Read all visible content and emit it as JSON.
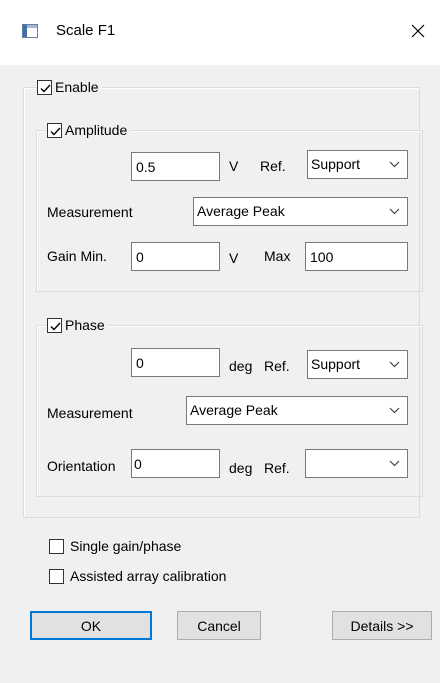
{
  "window": {
    "title": "Scale F1",
    "app_icon": "window-icon",
    "close_icon": "close-icon"
  },
  "enable": {
    "label": "Enable",
    "checked": true
  },
  "amplitude": {
    "label": "Amplitude",
    "checked": true,
    "value": "0.5",
    "unit": "V",
    "ref_label": "Ref.",
    "ref_value": "Support",
    "measurement_label": "Measurement",
    "measurement_value": "Average Peak",
    "gain_min_label": "Gain Min.",
    "gain_min_value": "0",
    "gain_min_unit": "V",
    "max_label": "Max",
    "max_value": "100"
  },
  "phase": {
    "label": "Phase",
    "checked": true,
    "value": "0",
    "unit": "deg",
    "ref_label": "Ref.",
    "ref_value": "Support",
    "measurement_label": "Measurement",
    "measurement_value": "Average Peak",
    "orientation_label": "Orientation",
    "orientation_value": "0",
    "orientation_unit": "deg",
    "orientation_ref_label": "Ref.",
    "orientation_ref_value": ""
  },
  "options": {
    "single_gain_phase": {
      "label": "Single gain/phase",
      "checked": false
    },
    "assisted_calibration": {
      "label": "Assisted array calibration",
      "checked": false
    }
  },
  "buttons": {
    "ok": "OK",
    "cancel": "Cancel",
    "details": "Details >>"
  },
  "colors": {
    "focus_border": "#0078d7",
    "background": "#f0f0f0"
  }
}
